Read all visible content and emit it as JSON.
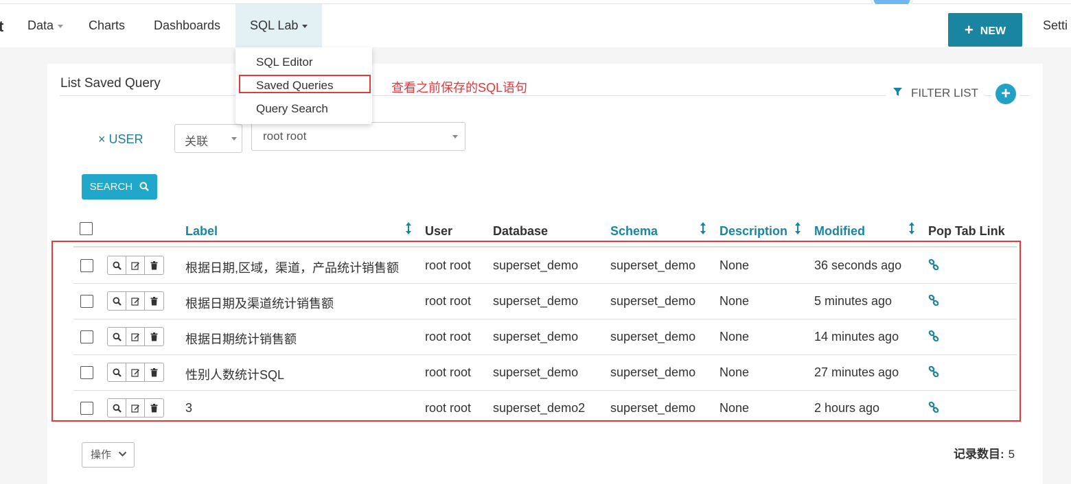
{
  "nav": {
    "brand_fragment": "t",
    "items": [
      {
        "label": "Data"
      },
      {
        "label": "Charts"
      },
      {
        "label": "Dashboards"
      },
      {
        "label": "SQL Lab"
      }
    ],
    "new_button": "NEW",
    "settings": "Setti"
  },
  "sql_lab_menu": {
    "items": [
      "SQL Editor",
      "Saved Queries",
      "Query Search"
    ],
    "highlighted": "Saved Queries"
  },
  "annotation": "查看之前保存的SQL语句",
  "panel": {
    "title": "List Saved Query",
    "filter_list": "FILTER LIST"
  },
  "filters": {
    "user_label": "× USER",
    "relation": "关联",
    "value": "root root",
    "search_button": "SEARCH"
  },
  "table": {
    "columns": {
      "label": "Label",
      "user": "User",
      "database": "Database",
      "schema": "Schema",
      "description": "Description",
      "modified": "Modified",
      "pop_tab_link": "Pop Tab Link"
    },
    "rows": [
      {
        "label": "根据日期,区域，渠道，产品统计销售额",
        "user": "root root",
        "database": "superset_demo",
        "schema": "superset_demo",
        "description": "None",
        "modified": "36 seconds ago"
      },
      {
        "label": "根据日期及渠道统计销售额",
        "user": "root root",
        "database": "superset_demo",
        "schema": "superset_demo",
        "description": "None",
        "modified": "5 minutes ago"
      },
      {
        "label": "根据日期统计销售额",
        "user": "root root",
        "database": "superset_demo",
        "schema": "superset_demo",
        "description": "None",
        "modified": "14 minutes ago"
      },
      {
        "label": "性别人数统计SQL",
        "user": "root root",
        "database": "superset_demo",
        "schema": "superset_demo",
        "description": "None",
        "modified": "27 minutes ago"
      },
      {
        "label": "3",
        "user": "root root",
        "database": "superset_demo2",
        "schema": "superset_demo",
        "description": "None",
        "modified": "2 hours ago"
      }
    ]
  },
  "footer": {
    "action_button": "操作",
    "record_count_label": "记录数目:",
    "record_count": "5"
  },
  "colors": {
    "accent": "#1a85a0",
    "button_blue": "#20a7c9",
    "annotation_red": "#e0393e"
  }
}
